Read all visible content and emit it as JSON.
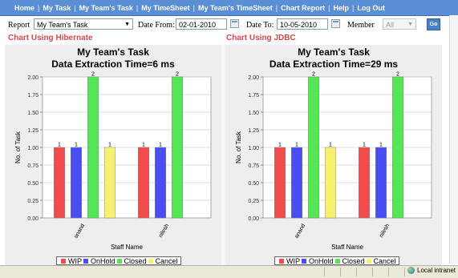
{
  "nav": [
    "Home",
    "My Task",
    "My Team's Task",
    "My TimeSheet",
    "My Team's TimeSheet",
    "Chart Report",
    "Help",
    "Log Out"
  ],
  "form": {
    "report_label": "Report",
    "report_value": "My Team's Task",
    "date_from_label": "Date From:",
    "date_from_value": "02-01-2010",
    "date_to_label": "Date To:",
    "date_to_value": "10-05-2010",
    "member_label": "Member",
    "member_value": "All",
    "go_label": "Go"
  },
  "panels": [
    {
      "heading": "Chart Using Hibernate",
      "title": "My Team's Task",
      "subtitle": "Data Extraction Time=6 ms"
    },
    {
      "heading": "Chart Using JDBC",
      "title": "My Team's Task",
      "subtitle": "Data Extraction Time=29 ms"
    }
  ],
  "chart_data": [
    {
      "type": "bar",
      "title": "My Team's Task",
      "subtitle": "Data Extraction Time=6 ms",
      "xlabel": "Staff Name",
      "ylabel": "No. of Task",
      "ylim": [
        0,
        2
      ],
      "yticks": [
        "0.00",
        "0.25",
        "0.50",
        "0.75",
        "1.00",
        "1.25",
        "1.50",
        "1.75",
        "2.00"
      ],
      "grid": true,
      "legend_position": "bottom",
      "categories": [
        "anand",
        "nilesh"
      ],
      "series": [
        {
          "name": "WIP",
          "color": "#f04c4c",
          "values": [
            1,
            1
          ]
        },
        {
          "name": "OnHold",
          "color": "#4a4ef0",
          "values": [
            1,
            1
          ]
        },
        {
          "name": "Closed",
          "color": "#55e655",
          "values": [
            2,
            2
          ]
        },
        {
          "name": "Cancel",
          "color": "#f8f070",
          "values": [
            1,
            null
          ]
        }
      ]
    },
    {
      "type": "bar",
      "title": "My Team's Task",
      "subtitle": "Data Extraction Time=29 ms",
      "xlabel": "Staff Name",
      "ylabel": "No. of Task",
      "ylim": [
        0,
        2
      ],
      "yticks": [
        "0.00",
        "0.25",
        "0.50",
        "0.75",
        "1.00",
        "1.25",
        "1.50",
        "1.75",
        "2.00"
      ],
      "grid": true,
      "legend_position": "bottom",
      "categories": [
        "anand",
        "nilesh"
      ],
      "series": [
        {
          "name": "WIP",
          "color": "#f04c4c",
          "values": [
            1,
            1
          ]
        },
        {
          "name": "OnHold",
          "color": "#4a4ef0",
          "values": [
            1,
            1
          ]
        },
        {
          "name": "Closed",
          "color": "#55e655",
          "values": [
            2,
            2
          ]
        },
        {
          "name": "Cancel",
          "color": "#f8f070",
          "values": [
            1,
            null
          ]
        }
      ]
    }
  ],
  "status": {
    "zone": "Local intranet"
  },
  "colors": {
    "nav_bg": "#5a8fd6",
    "heading": "#d2494b"
  }
}
